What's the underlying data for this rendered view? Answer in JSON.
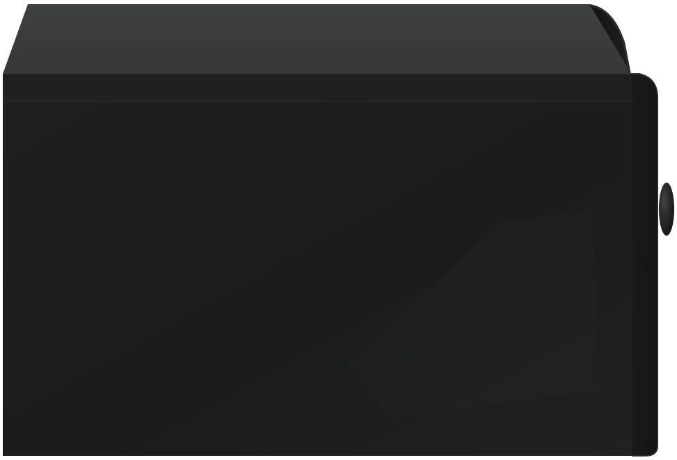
{
  "image": {
    "subject": "black-wall-mounted-nightstand-side-view",
    "colors": {
      "background": "#ffffff",
      "top_face": "#3a3c3d",
      "top_edge": "#1f2121",
      "body_face": "#1c1d1e",
      "drawer_front": "#161717",
      "drawer_front_highlight": "#2a2c2d",
      "knob": "#1a1b1c",
      "knob_highlight": "#3b3d3f"
    }
  }
}
